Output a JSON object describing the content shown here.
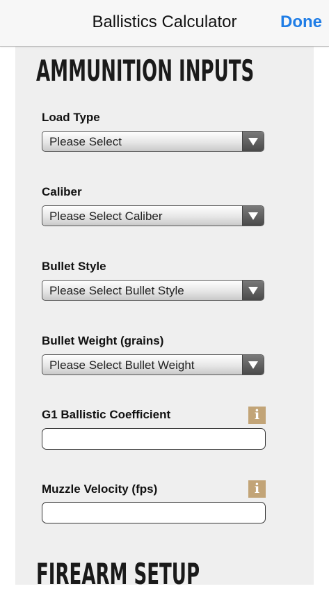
{
  "navbar": {
    "title": "Ballistics Calculator",
    "done_label": "Done"
  },
  "sections": {
    "ammo_title": "AMMUNITION INPUTS",
    "firearm_title": "FIREARM SETUP"
  },
  "fields": {
    "load_type": {
      "label": "Load Type",
      "value": "Please Select"
    },
    "caliber": {
      "label": "Caliber",
      "value": "Please Select Caliber"
    },
    "bullet_style": {
      "label": "Bullet Style",
      "value": "Please Select Bullet Style"
    },
    "bullet_weight": {
      "label": "Bullet Weight (grains)",
      "value": "Please Select Bullet Weight"
    },
    "g1_bc": {
      "label": "G1 Ballistic Coefficient",
      "value": "",
      "info_icon": "i"
    },
    "muzzle_velocity": {
      "label": "Muzzle Velocity (fps)",
      "value": "",
      "info_icon": "i"
    }
  },
  "colors": {
    "accent": "#1f7de6",
    "info": "#c2a477",
    "panel": "#efefef"
  }
}
